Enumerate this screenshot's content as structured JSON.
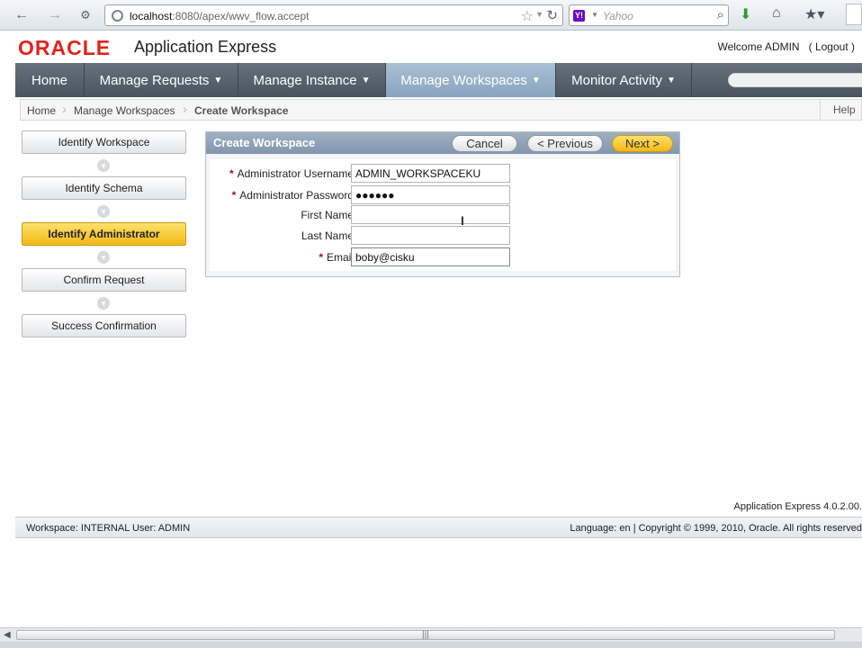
{
  "browser": {
    "url_host": "localhost",
    "url_rest": ":8080/apex/wwv_flow.accept",
    "search_engine": "Yahoo",
    "yahoo_logo": "Y!",
    "icons": [
      "back-arrow-icon",
      "forward-arrow-icon",
      "site-identity-icon",
      "star-icon",
      "reload-icon",
      "search-icon",
      "download-icon",
      "home-icon",
      "bookmark-icon"
    ]
  },
  "header": {
    "brand": "ORACLE",
    "app_name": "Application Express",
    "welcome": "Welcome ADMIN",
    "logout": "( Logout )",
    "brand_color": "#e2231a"
  },
  "tabs": [
    {
      "label": "Home",
      "dropdown": false
    },
    {
      "label": "Manage Requests",
      "dropdown": true
    },
    {
      "label": "Manage Instance",
      "dropdown": true
    },
    {
      "label": "Manage Workspaces",
      "dropdown": true,
      "active": true
    },
    {
      "label": "Monitor Activity",
      "dropdown": true
    }
  ],
  "breadcrumb": {
    "items": [
      "Home",
      "Manage Workspaces",
      "Create Workspace"
    ],
    "help": "Help"
  },
  "wizard": {
    "steps": [
      {
        "label": "Identify Workspace"
      },
      {
        "label": "Identify Schema"
      },
      {
        "label": "Identify Administrator",
        "active": true
      },
      {
        "label": "Confirm Request"
      },
      {
        "label": "Success Confirmation"
      }
    ]
  },
  "region": {
    "title": "Create Workspace",
    "buttons": {
      "cancel": "Cancel",
      "previous": "< Previous",
      "next": "Next >"
    },
    "fields": [
      {
        "label": "Administrator Username",
        "required": true,
        "value": "ADMIN_WORKSPACEKU"
      },
      {
        "label": "Administrator Password",
        "required": true,
        "value": "●●●●●●"
      },
      {
        "label": "First Name",
        "required": false,
        "value": ""
      },
      {
        "label": "Last Name",
        "required": false,
        "value": ""
      },
      {
        "label": "Email",
        "required": true,
        "value": "boby@cisku"
      }
    ],
    "required_marker": "*"
  },
  "footer": {
    "version": "Application Express 4.0.2.00.",
    "workspace_info": "Workspace: INTERNAL User: ADMIN",
    "language_copyright": "Language: en | Copyright © 1999, 2010, Oracle. All rights reserved"
  },
  "colors": {
    "tab_bar": "#4f5a66",
    "active_tab": "#98b1c9",
    "active_step": "#f5c42c",
    "region_header": "#8fa2b7"
  }
}
